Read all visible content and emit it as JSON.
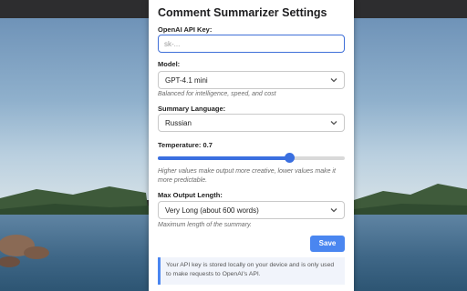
{
  "settings": {
    "title": "Comment Summarizer Settings",
    "api_key": {
      "label": "OpenAI API Key:",
      "value": "",
      "placeholder": "sk-..."
    },
    "model": {
      "label": "Model:",
      "selected": "GPT-4.1 mini",
      "hint": "Balanced for intelligence, speed, and cost"
    },
    "language": {
      "label": "Summary Language:",
      "selected": "Russian"
    },
    "temperature": {
      "label": "Temperature: 0.7",
      "value": 0.7,
      "min": 0,
      "max": 1,
      "hint": "Higher values make output more creative, lower values make it more predictable."
    },
    "max_length": {
      "label": "Max Output Length:",
      "selected": "Very Long (about 600 words)",
      "hint": "Maximum length of the summary."
    },
    "save_label": "Save",
    "note": "Your API key is stored locally on your device and is only used to make requests to OpenAI's API."
  },
  "colors": {
    "accent": "#4a86f0",
    "slider": "#3a6fe0",
    "focus_border": "#3f6fd8"
  }
}
